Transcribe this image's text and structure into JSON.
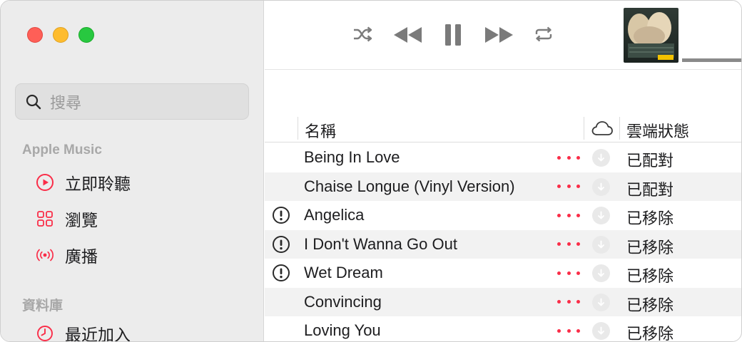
{
  "sidebar": {
    "search_placeholder": "搜尋",
    "sections": [
      {
        "title": "Apple Music",
        "items": [
          {
            "label": "立即聆聽",
            "icon": "play-circle-icon"
          },
          {
            "label": "瀏覽",
            "icon": "grid-icon"
          },
          {
            "label": "廣播",
            "icon": "broadcast-icon"
          }
        ]
      },
      {
        "title": "資料庫",
        "items": [
          {
            "label": "最近加入",
            "icon": "clock-icon"
          }
        ]
      }
    ]
  },
  "toolbar": {
    "controls": [
      "shuffle-icon",
      "rewind-icon",
      "pause-icon",
      "fast-forward-icon",
      "repeat-icon"
    ]
  },
  "columns": {
    "name": "名稱",
    "cloud_icon": "cloud-icon",
    "cloud_status": "雲端狀態"
  },
  "songs": [
    {
      "title": "Being In Love",
      "status": "已配對",
      "alert": false
    },
    {
      "title": "Chaise Longue (Vinyl Version)",
      "status": "已配對",
      "alert": false
    },
    {
      "title": "Angelica",
      "status": "已移除",
      "alert": true
    },
    {
      "title": "I Don't Wanna Go Out",
      "status": "已移除",
      "alert": true
    },
    {
      "title": "Wet Dream",
      "status": "已移除",
      "alert": true
    },
    {
      "title": "Convincing",
      "status": "已移除",
      "alert": false
    },
    {
      "title": "Loving You",
      "status": "已移除",
      "alert": false
    }
  ],
  "colors": {
    "accent": "#fa2d48",
    "sidebar_bg": "#ececec",
    "row_alt": "#f2f2f2"
  }
}
